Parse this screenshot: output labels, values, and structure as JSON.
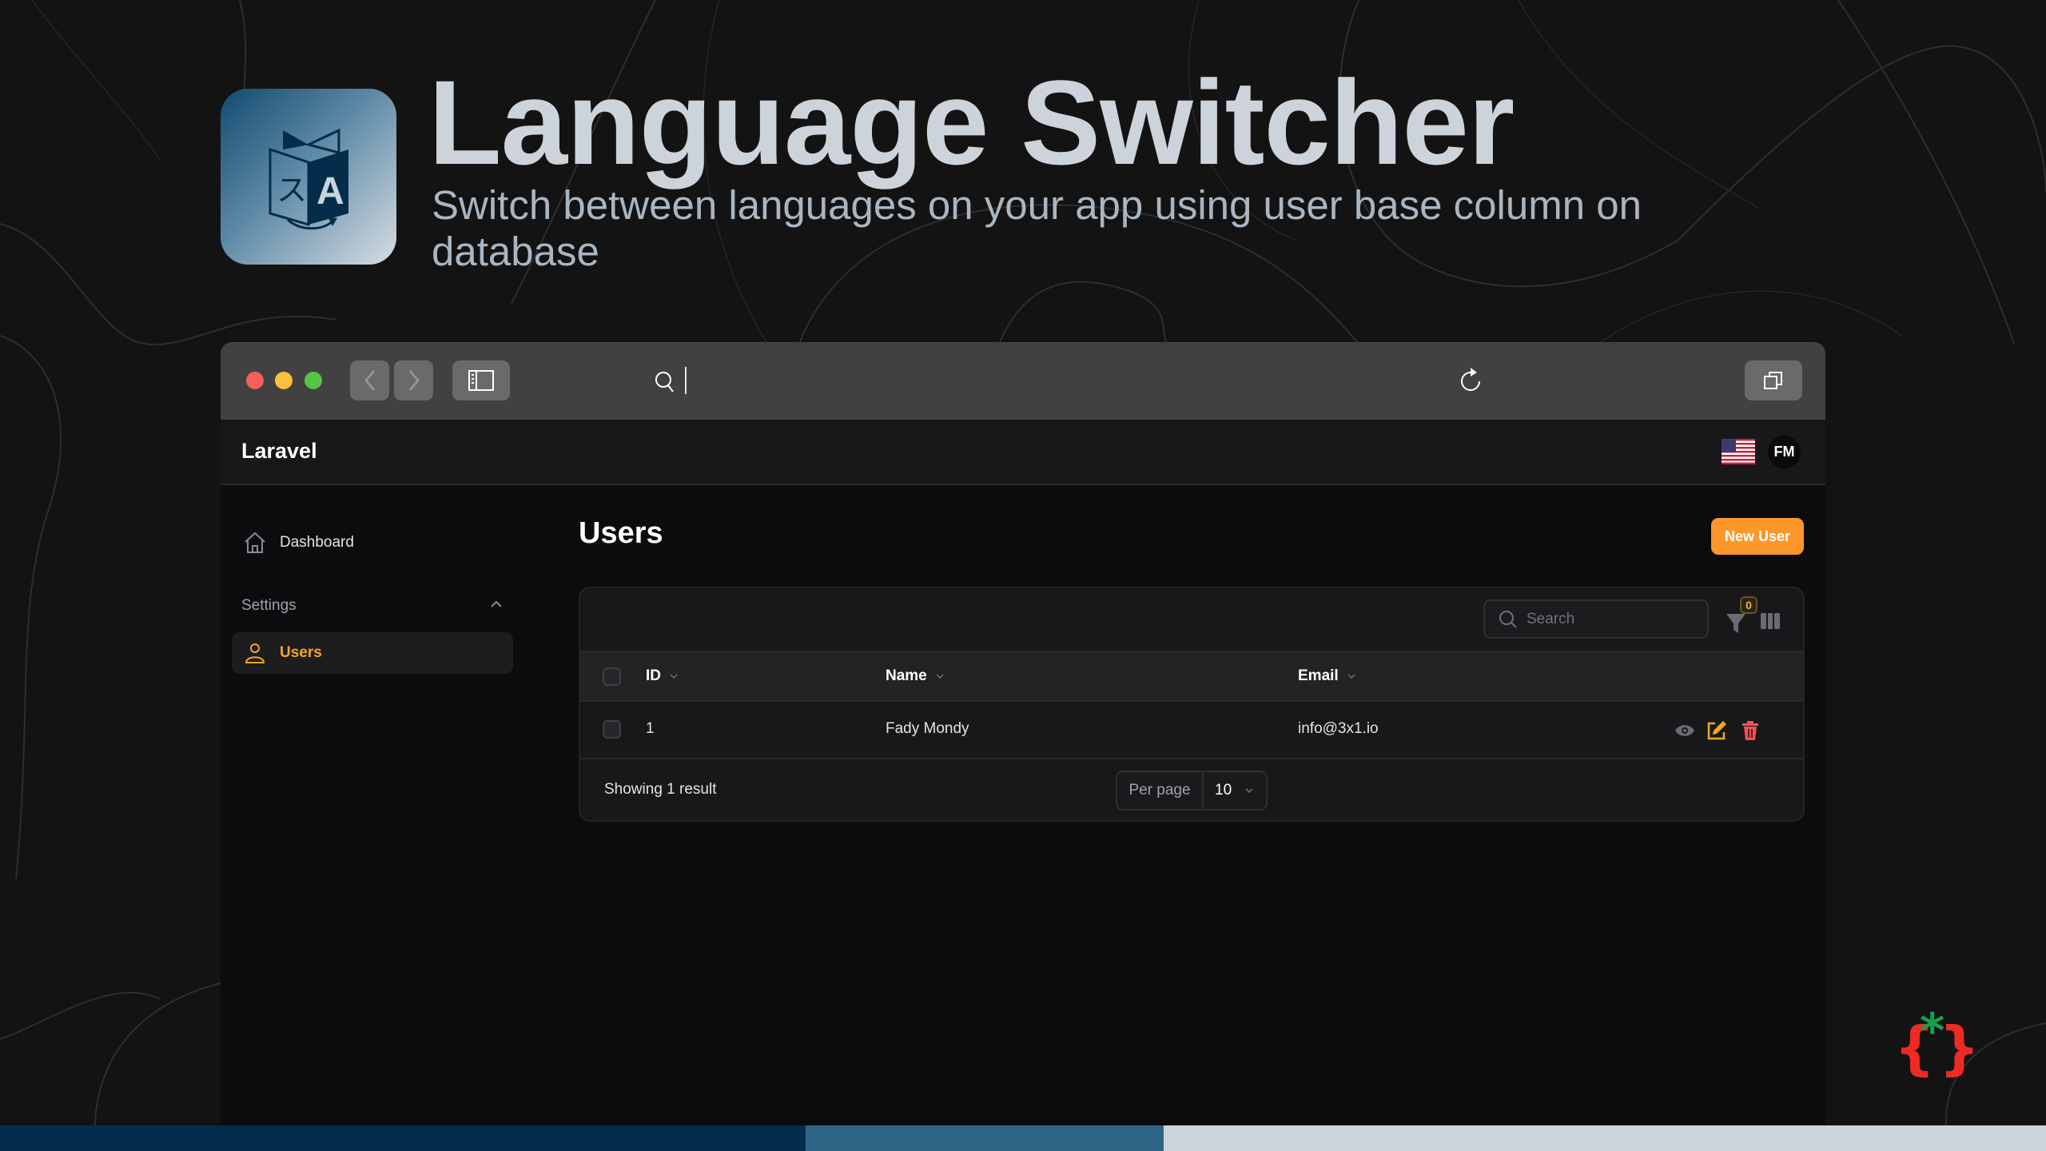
{
  "hero": {
    "title": "Language Switcher",
    "subtitle": "Switch between languages on your app using user base column on database",
    "icon": "translate-book-icon"
  },
  "browser": {
    "url_value": "",
    "toolbar_icons": [
      "back-icon",
      "forward-icon",
      "sidebar-icon",
      "search-icon",
      "reload-icon",
      "tabs-icon"
    ]
  },
  "app": {
    "brand": "Laravel",
    "locale_flag": "us-flag",
    "user_initials": "FM"
  },
  "sidebar": {
    "items": [
      {
        "label": "Dashboard",
        "icon": "home-icon",
        "active": false
      }
    ],
    "groups": [
      {
        "label": "Settings",
        "expanded": true,
        "items": [
          {
            "label": "Users",
            "icon": "user-icon",
            "active": true
          }
        ]
      }
    ]
  },
  "page": {
    "title": "Users",
    "new_button": "New User"
  },
  "table": {
    "search_placeholder": "Search",
    "filter_count": "0",
    "columns": [
      "ID",
      "Name",
      "Email"
    ],
    "rows": [
      {
        "id": "1",
        "name": "Fady Mondy",
        "email": "info@3x1.io",
        "actions": [
          "view",
          "edit",
          "delete"
        ]
      }
    ],
    "footer": {
      "showing": "Showing 1 result",
      "per_page_label": "Per page",
      "per_page_value": "10"
    }
  },
  "colors": {
    "accent": "#fb972b",
    "active_nav": "#f5a623",
    "delete": "#f05252",
    "bottom_bar": [
      "#032d4b",
      "#2e6485",
      "#cdd4dc"
    ]
  }
}
